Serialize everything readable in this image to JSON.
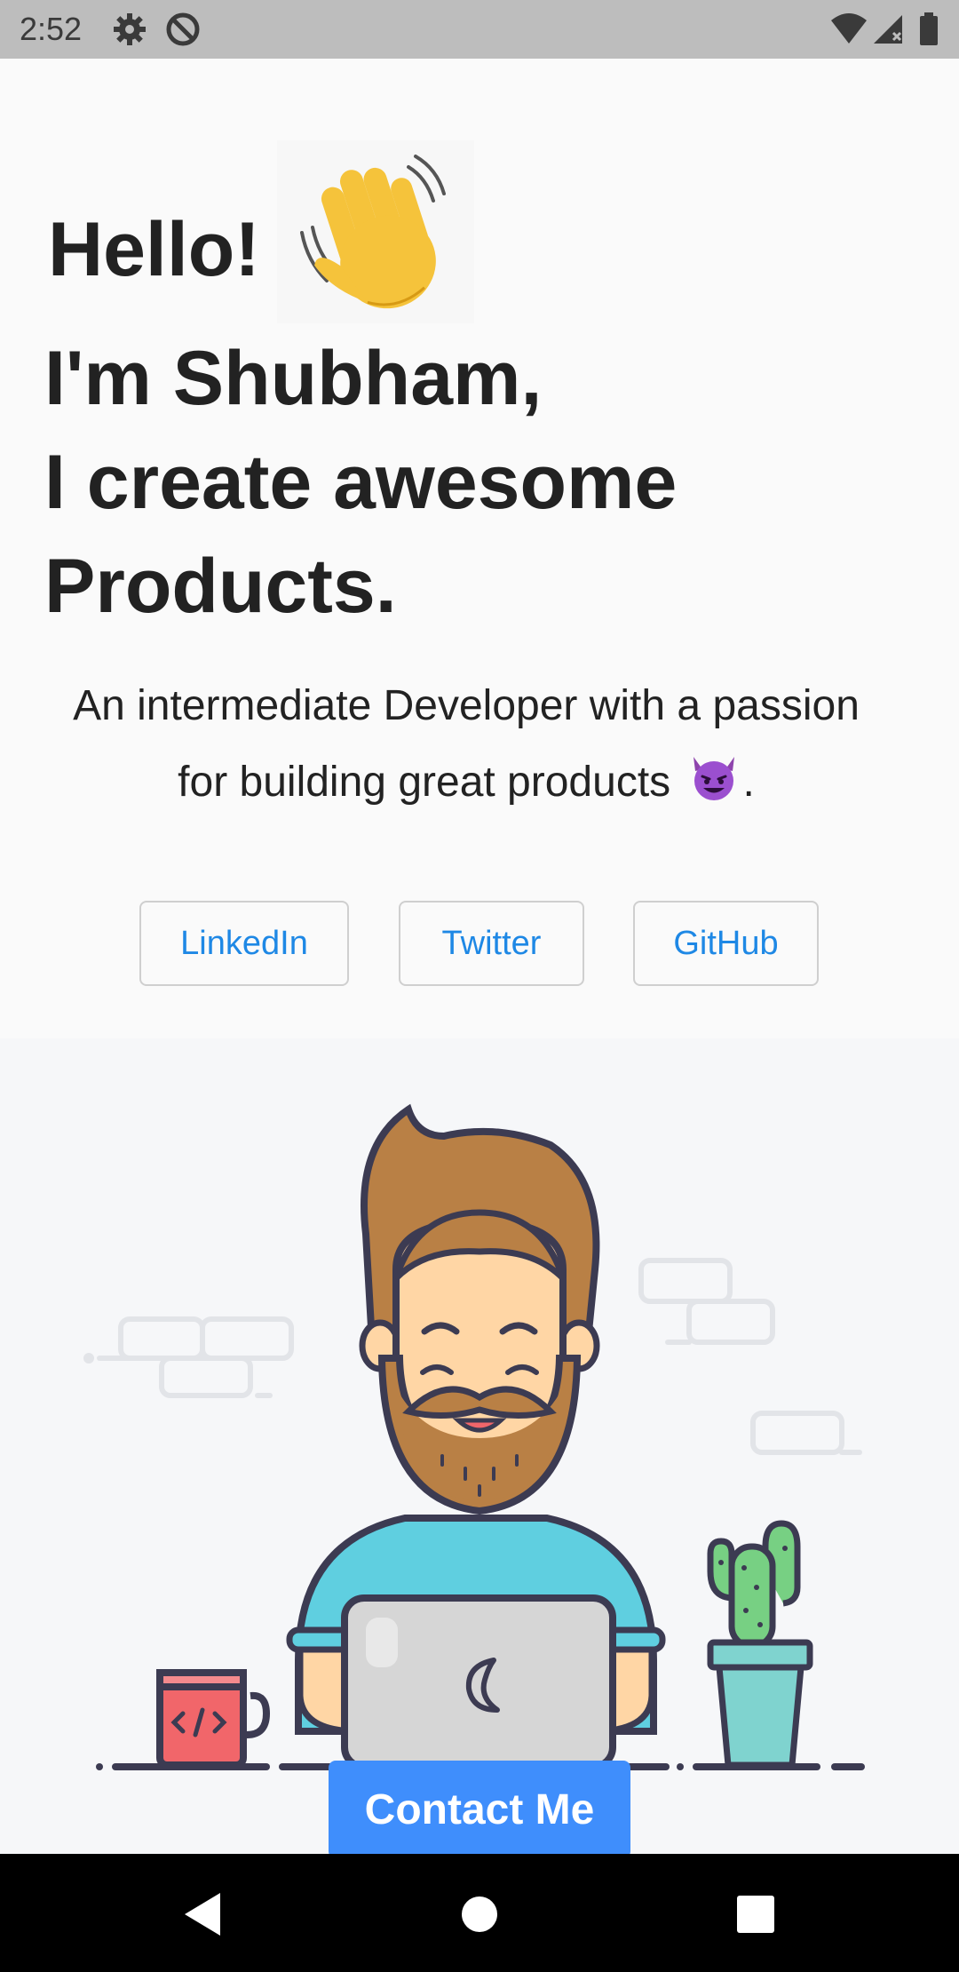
{
  "status_bar": {
    "time": "2:52"
  },
  "header": {
    "greeting": "Hello!",
    "wave_emoji": "waving-hand",
    "line1": "I'm Shubham,",
    "line2": "I create awesome",
    "line3": "Products."
  },
  "tagline": {
    "text": "An intermediate Developer with a passion for building great products",
    "emoji": "smiling-devil",
    "suffix": "."
  },
  "social": {
    "linkedin": "LinkedIn",
    "twitter": "Twitter",
    "github": "GitHub"
  },
  "contact": {
    "label": "Contact Me"
  },
  "colors": {
    "accent": "#3f8efc",
    "link": "#1e88e5",
    "text": "#222222"
  }
}
